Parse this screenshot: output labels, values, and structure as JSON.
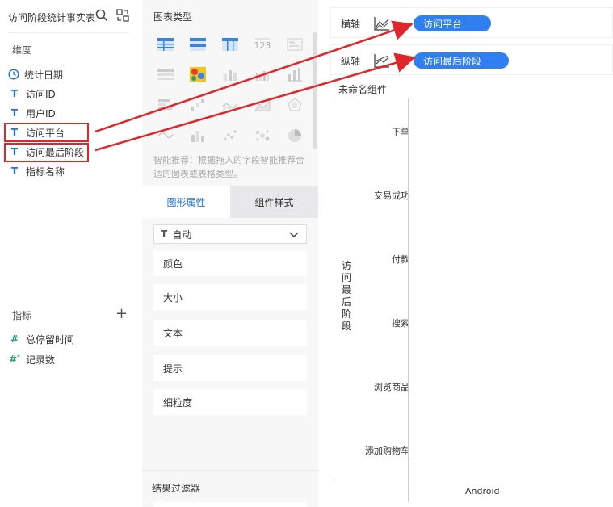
{
  "left": {
    "dataset_title": "访问阶段统计事实表",
    "dimensions_label": "维度",
    "dimensions": [
      {
        "icon": "clock-icon",
        "label": "统计日期"
      },
      {
        "icon": "text-type-icon",
        "label": "访问ID"
      },
      {
        "icon": "text-type-icon",
        "label": "用户ID"
      },
      {
        "icon": "text-type-icon",
        "label": "访问平台"
      },
      {
        "icon": "text-type-icon",
        "label": "访问最后阶段"
      },
      {
        "icon": "text-type-icon",
        "label": "指标名称"
      }
    ],
    "measures_label": "指标",
    "measures": [
      {
        "icon": "number-type-icon",
        "label": "总停留时间"
      },
      {
        "icon": "calculated-number-icon",
        "label": "记录数"
      }
    ]
  },
  "middle": {
    "chart_type_title": "图表类型",
    "tip": "智能推荐：根据拖入的字段智能推荐合适的图表或表格类型。",
    "tabs": [
      "图形属性",
      "组件样式"
    ],
    "select_value": "自动",
    "properties": [
      "颜色",
      "大小",
      "文本",
      "提示",
      "细粒度"
    ],
    "filter_title": "结果过滤器"
  },
  "right": {
    "x_axis_label": "横轴",
    "x_axis_field": "访问平台",
    "y_axis_label": "纵轴",
    "y_axis_field": "访问最后阶段",
    "component_name": "未命名组件",
    "y_title": "访问最后阶段",
    "categories": [
      "下单",
      "交易成功",
      "付款",
      "搜索",
      "浏览商品",
      "添加购物车"
    ],
    "x_tick": "Android"
  },
  "colors": {
    "accent": "#2f7ff0",
    "highlight": "#e0262a"
  }
}
